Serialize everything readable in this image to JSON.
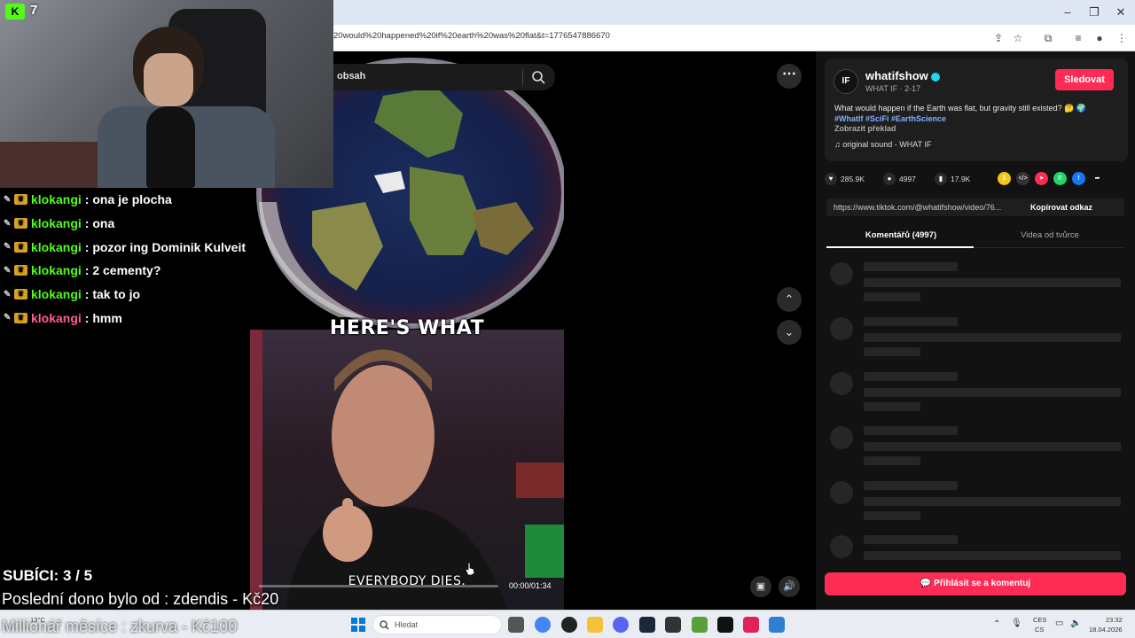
{
  "browser": {
    "url": "20would%20happened%20if%20earth%20was%20flat&t=1776547886670"
  },
  "tiktok": {
    "search_placeholder": "obsah",
    "video": {
      "caption_top": "HERE'S WHAT",
      "caption_bottom": "EVERYBODY DIES.",
      "timecode": "00:00/01:34",
      "progress": 0.0
    },
    "author": {
      "username": "whatifshow",
      "subtitle": "WHAT IF · 2-17",
      "avatar_text": "IF",
      "follow_label": "Sledovat",
      "description": "What would happen if the Earth was flat, but gravity still existed? 🤔 🌍",
      "tags": "#WhatIf #SciFi #EarthScience",
      "translate_label": "Zobrazit překlad",
      "sound": "♫  original sound - WHAT IF"
    },
    "stats": {
      "likes": "285.9K",
      "comments": "4997",
      "saves": "17.9K"
    },
    "share_link": "https://www.tiktok.com/@whatifshow/video/76...",
    "copy_link_label": "Kopírovat odkaz",
    "tabs": [
      "Komentářů (4997)",
      "Videa od tvůrce"
    ],
    "comment_button": "💬 Přihlásit se a komentuj"
  },
  "stream": {
    "kick_count": "7",
    "chat": [
      {
        "user": "klokangi",
        "text": ": ona je plocha",
        "color": "#53fc18"
      },
      {
        "user": "klokangi",
        "text": ": ona",
        "color": "#53fc18"
      },
      {
        "user": "klokangi",
        "text": ": pozor ing Dominik Kulveit",
        "color": "#53fc18"
      },
      {
        "user": "klokangi",
        "text": ": 2 cementy?",
        "color": "#53fc18"
      },
      {
        "user": "klokangi",
        "text": ": tak to jo",
        "color": "#53fc18"
      },
      {
        "user": "klokangi",
        "text": ": hmm",
        "color": "#ff5f8f"
      }
    ],
    "subs": "SUBÍCI: 3 / 5",
    "last_dono": "Poslední dono bylo od : zdendis - Kč20",
    "million": "Millionář měsíce : zkurva - Kč100"
  },
  "taskbar": {
    "search_label": "Hledat",
    "weather": "13°C",
    "lang_top": "CES",
    "lang_bottom": "CS",
    "time": "23:32",
    "date": "18.04.2026"
  },
  "colors": {
    "accent": "#fe2c55",
    "kick_green": "#53fc18"
  }
}
